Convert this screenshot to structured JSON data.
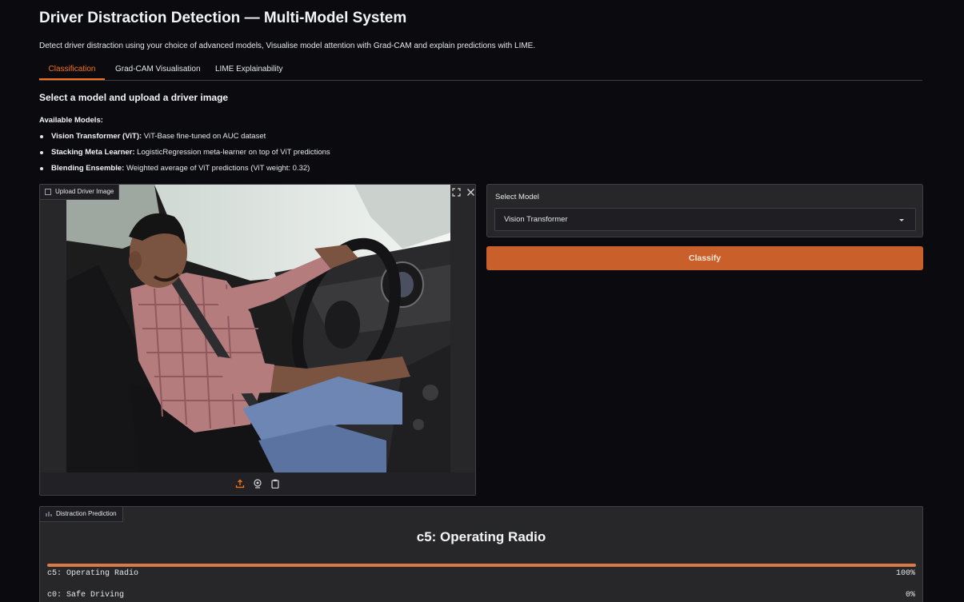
{
  "header": {
    "title": "Driver Distraction Detection — Multi-Model System",
    "description": "Detect driver distraction using your choice of advanced models, Visualise model attention with Grad-CAM and explain predictions with LIME."
  },
  "tabs": [
    {
      "label": "Classification",
      "active": true
    },
    {
      "label": "Grad-CAM Visualisation",
      "active": false
    },
    {
      "label": "LIME Explainability",
      "active": false
    }
  ],
  "classification": {
    "heading": "Select a model and upload a driver image",
    "models_label": "Available Models:",
    "models": [
      {
        "name": "Vision Transformer (ViT):",
        "desc": " ViT-Base fine-tuned on AUC dataset"
      },
      {
        "name": "Stacking Meta Learner:",
        "desc": " LogisticRegression meta-learner on top of ViT predictions"
      },
      {
        "name": "Blending Ensemble:",
        "desc": " Weighted average of ViT predictions (ViT weight: 0.32)"
      }
    ],
    "upload": {
      "label": "Upload Driver Image",
      "icons": [
        "image-icon",
        "fullscreen-icon",
        "close-icon",
        "upload-icon",
        "webcam-icon",
        "clipboard-icon"
      ]
    },
    "select_model": {
      "label": "Select Model",
      "value": "Vision Transformer"
    },
    "classify_label": "Classify",
    "prediction": {
      "label": "Distraction Prediction",
      "title": "c5: Operating Radio",
      "rows": [
        {
          "label": "c5: Operating Radio",
          "value": "100%",
          "fraction": 1.0
        },
        {
          "label": "c0: Safe Driving",
          "value": "0%",
          "fraction": 0.0
        }
      ]
    }
  },
  "colors": {
    "accent": "#f97316",
    "button": "#c95f2b",
    "background": "#0b0b0f",
    "panel": "#27272a"
  }
}
